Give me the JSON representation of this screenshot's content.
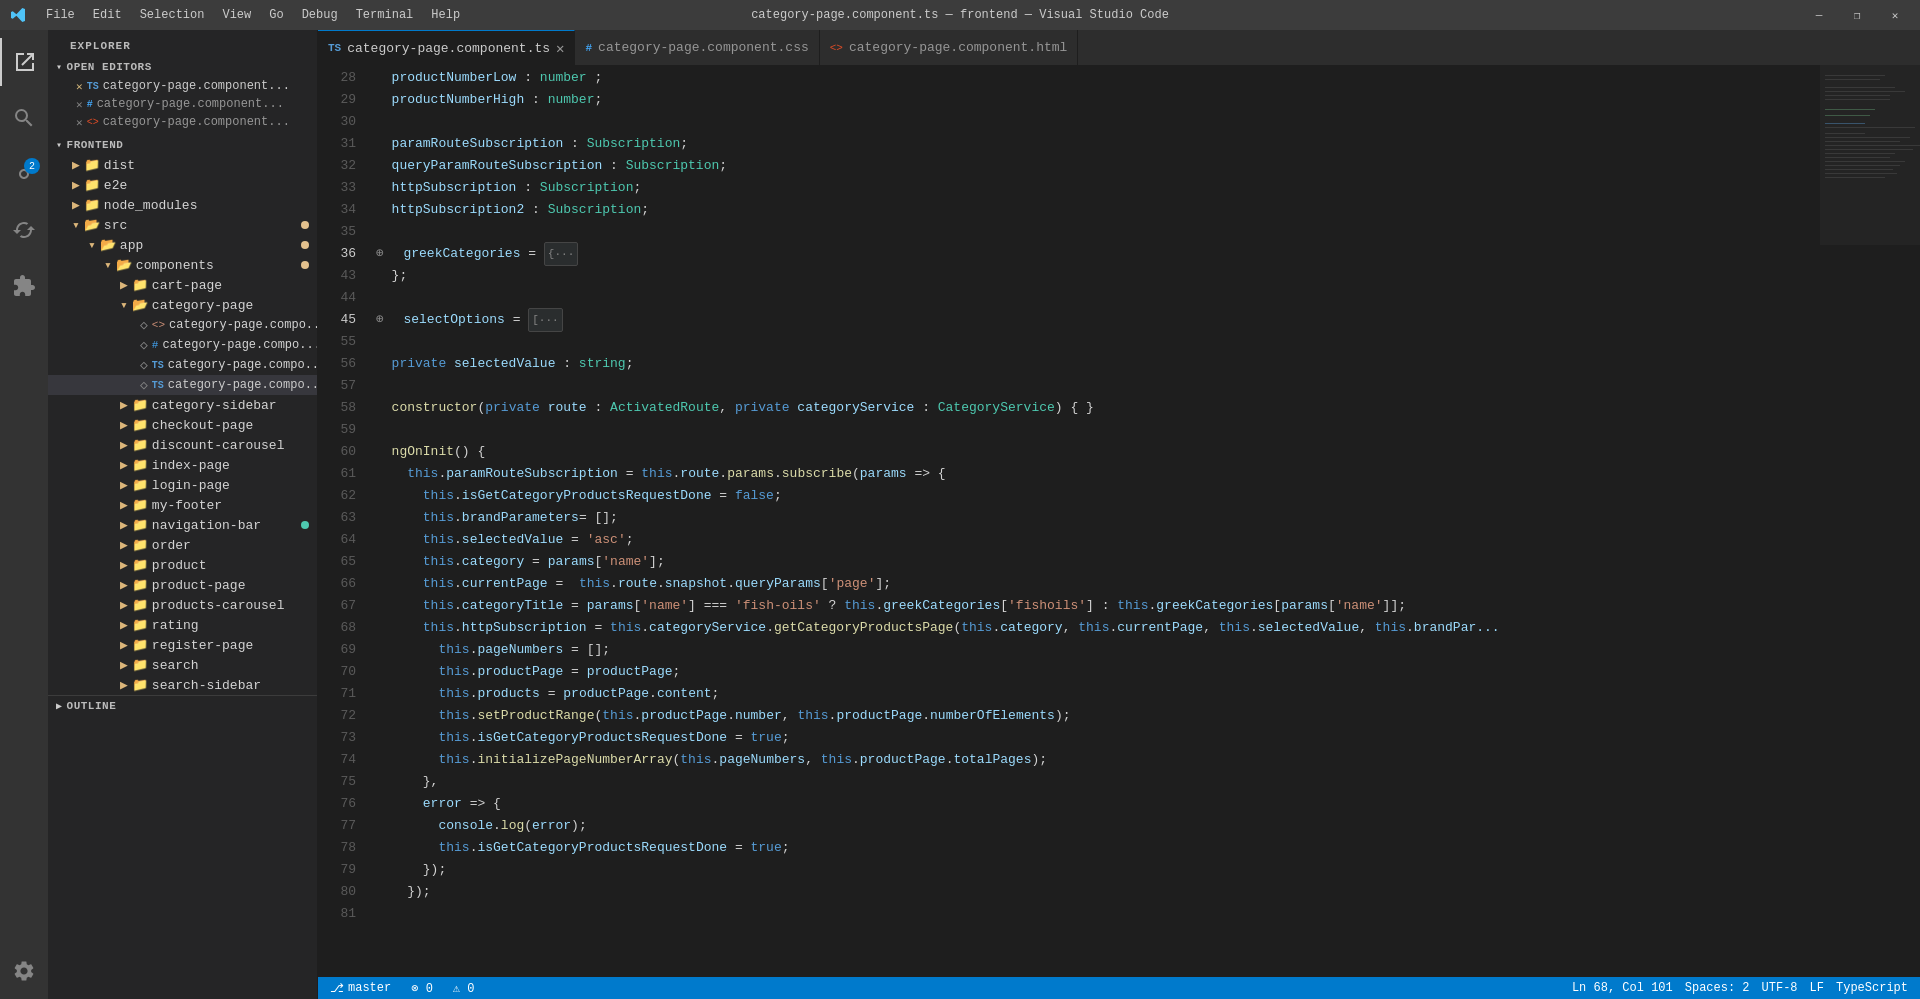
{
  "titleBar": {
    "title": "category-page.component.ts — frontend — Visual Studio Code",
    "menus": [
      "File",
      "Edit",
      "Selection",
      "View",
      "Go",
      "Debug",
      "Terminal",
      "Help"
    ],
    "buttons": [
      "—",
      "❐",
      "✕"
    ]
  },
  "tabs": [
    {
      "id": "ts",
      "label": "category-page.component.ts",
      "icon": "TS",
      "type": "ts",
      "active": true,
      "dirty": false
    },
    {
      "id": "css",
      "label": "category-page.component.css",
      "icon": "#",
      "type": "css",
      "active": false,
      "dirty": false
    },
    {
      "id": "html",
      "label": "category-page.component.html",
      "icon": "<>",
      "type": "html",
      "active": false,
      "dirty": false
    }
  ],
  "explorer": {
    "title": "EXPLORER",
    "openEditors": {
      "label": "OPEN EDITORS",
      "items": [
        {
          "name": "category-page.component...",
          "type": "ts",
          "dirty": true
        },
        {
          "name": "category-page.component...",
          "type": "css"
        },
        {
          "name": "category-page.component...",
          "type": "html"
        }
      ]
    },
    "frontend": {
      "label": "FRONTEND",
      "folders": [
        "dist",
        "e2e",
        "node_modules",
        "src"
      ],
      "src": {
        "app": {
          "components": {
            "items": [
              "cart-page",
              "category-page",
              "category-sidebar",
              "checkout-page",
              "discount-carousel",
              "index-page",
              "login-page",
              "my-footer",
              "navigation-bar",
              "order",
              "product",
              "product-page",
              "products-carousel",
              "rating",
              "register-page",
              "search",
              "search-sidebar"
            ]
          }
        }
      }
    },
    "outline": "OUTLINE"
  },
  "code": {
    "lines": [
      {
        "num": 28,
        "content": "  productNumberLow : number ;"
      },
      {
        "num": 29,
        "content": "  productNumberHigh : number;"
      },
      {
        "num": 30,
        "content": ""
      },
      {
        "num": 31,
        "content": "  paramRouteSubscription : Subscription;"
      },
      {
        "num": 32,
        "content": "  queryParamRouteSubscription : Subscription;"
      },
      {
        "num": 33,
        "content": "  httpSubscription : Subscription;"
      },
      {
        "num": 34,
        "content": "  httpSubscription2 : Subscription;"
      },
      {
        "num": 35,
        "content": ""
      },
      {
        "num": 36,
        "content": "  greekCategories = {···",
        "folded": true
      },
      {
        "num": 43,
        "content": "  };"
      },
      {
        "num": 44,
        "content": ""
      },
      {
        "num": 45,
        "content": "  selectOptions = [···",
        "folded": true
      },
      {
        "num": 55,
        "content": ""
      },
      {
        "num": 56,
        "content": "  private selectedValue : string;"
      },
      {
        "num": 57,
        "content": ""
      },
      {
        "num": 58,
        "content": "  constructor(private route : ActivatedRoute, private categoryService : CategoryService) { }"
      },
      {
        "num": 59,
        "content": ""
      },
      {
        "num": 60,
        "content": "  ngOnInit() {"
      },
      {
        "num": 61,
        "content": "    this.paramRouteSubscription = this.route.params.subscribe(params => {"
      },
      {
        "num": 62,
        "content": "      this.isGetCategoryProductsRequestDone = false;"
      },
      {
        "num": 63,
        "content": "      this.brandParameters= [];"
      },
      {
        "num": 64,
        "content": "      this.selectedValue = 'asc';"
      },
      {
        "num": 65,
        "content": "      this.category = params['name'];"
      },
      {
        "num": 66,
        "content": "      this.currentPage =  this.route.snapshot.queryParams['page'];"
      },
      {
        "num": 67,
        "content": "      this.categoryTitle = params['name'] === 'fish-oils' ? this.greekCategories['fishoils'] : this.greekCategories[params['name']];"
      },
      {
        "num": 68,
        "content": "      this.httpSubscription = this.categoryService.getCategoryProductsPage(this.category, this.currentPage, this.selectedValue, this.brandPar..."
      },
      {
        "num": 69,
        "content": "        this.pageNumbers = [];"
      },
      {
        "num": 70,
        "content": "        this.productPage = productPage;"
      },
      {
        "num": 71,
        "content": "        this.products = productPage.content;"
      },
      {
        "num": 72,
        "content": "        this.setProductRange(this.productPage.number, this.productPage.numberOfElements);"
      },
      {
        "num": 73,
        "content": "        this.isGetCategoryProductsRequestDone = true;"
      },
      {
        "num": 74,
        "content": "        this.initializePageNumberArray(this.pageNumbers, this.productPage.totalPages);"
      },
      {
        "num": 75,
        "content": "      },"
      },
      {
        "num": 76,
        "content": "      error => {"
      },
      {
        "num": 77,
        "content": "        console.log(error);"
      },
      {
        "num": 78,
        "content": "        this.isGetCategoryProductsRequestDone = true;"
      },
      {
        "num": 79,
        "content": "      });"
      },
      {
        "num": 80,
        "content": "    });"
      },
      {
        "num": 81,
        "content": ""
      }
    ]
  },
  "statusBar": {
    "branch": "⎇  master",
    "errors": "⊗ 0",
    "warnings": "⚠ 0",
    "position": "Ln 68, Col 101",
    "spaces": "Spaces: 2",
    "encoding": "UTF-8",
    "lineEnding": "LF",
    "language": "TypeScript"
  }
}
